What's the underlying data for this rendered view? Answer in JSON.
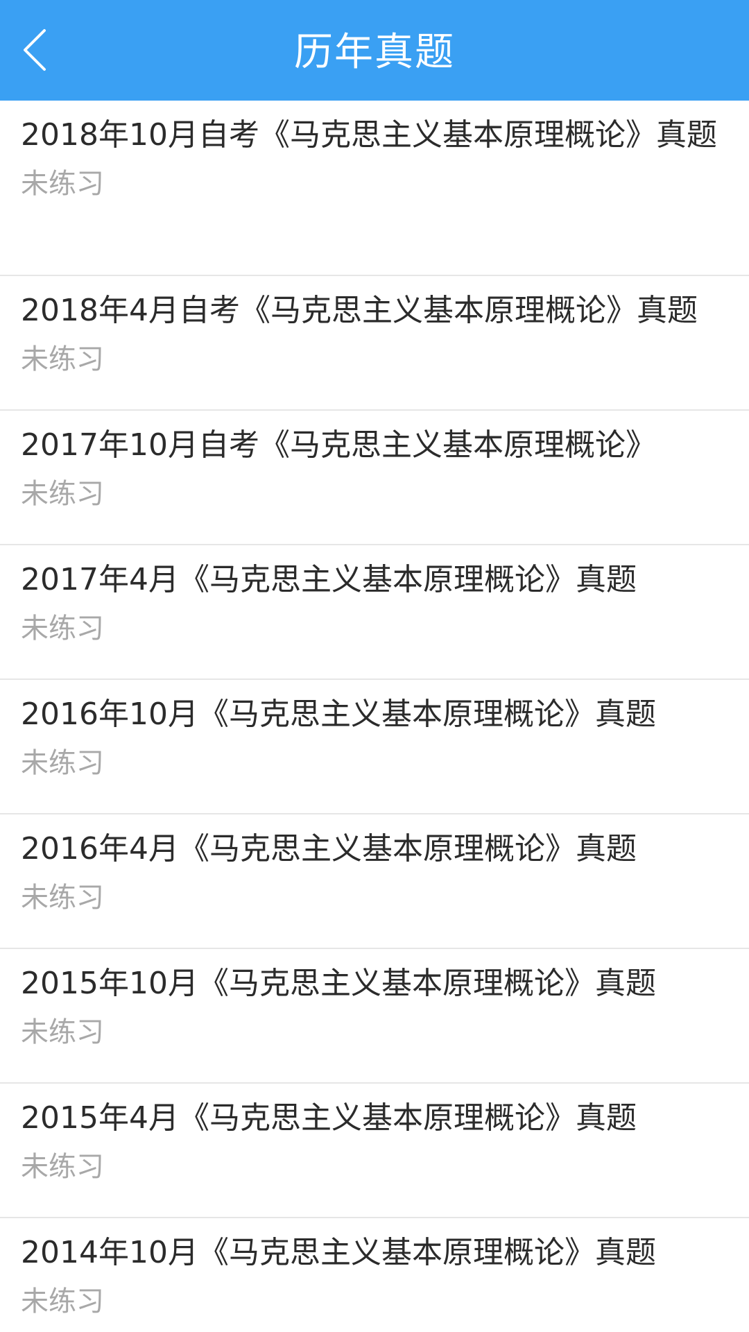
{
  "header": {
    "title": "历年真题"
  },
  "colors": {
    "header_bg": "#3aa0f3",
    "title_text": "#2b2b2b",
    "status_text": "#a8a8a8",
    "divider": "#e6e6e6"
  },
  "icons": {
    "back": "chevron-left-icon"
  },
  "items": [
    {
      "title": "2018年10月自考《马克思主义基本原理概论》真题",
      "status": "未练习"
    },
    {
      "title": "2018年4月自考《马克思主义基本原理概论》真题",
      "status": "未练习"
    },
    {
      "title": "2017年10月自考《马克思主义基本原理概论》",
      "status": "未练习"
    },
    {
      "title": "2017年4月《马克思主义基本原理概论》真题",
      "status": "未练习"
    },
    {
      "title": "2016年10月《马克思主义基本原理概论》真题",
      "status": "未练习"
    },
    {
      "title": "2016年4月《马克思主义基本原理概论》真题",
      "status": "未练习"
    },
    {
      "title": "2015年10月《马克思主义基本原理概论》真题",
      "status": "未练习"
    },
    {
      "title": "2015年4月《马克思主义基本原理概论》真题",
      "status": "未练习"
    },
    {
      "title": "2014年10月《马克思主义基本原理概论》真题",
      "status": "未练习"
    }
  ]
}
